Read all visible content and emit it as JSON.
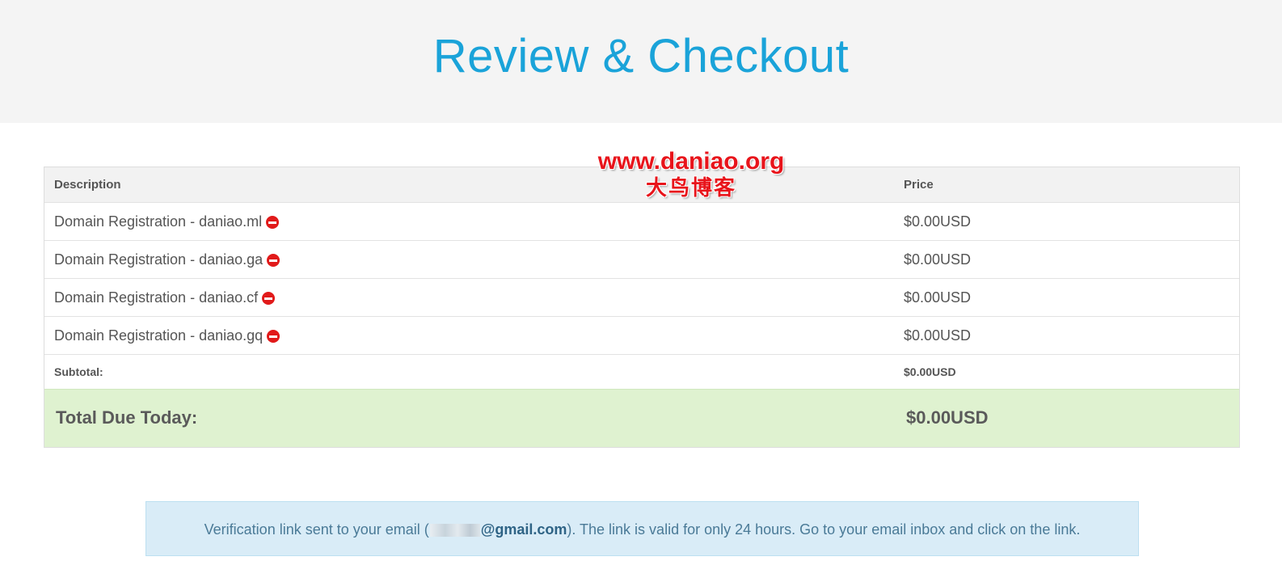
{
  "header": {
    "title": "Review & Checkout"
  },
  "watermark": {
    "url": "www.daniao.org",
    "cn": "大鸟博客"
  },
  "cart": {
    "columns": {
      "description": "Description",
      "price": "Price"
    },
    "items": [
      {
        "description": "Domain Registration - daniao.ml",
        "price": "$0.00USD"
      },
      {
        "description": "Domain Registration - daniao.ga",
        "price": "$0.00USD"
      },
      {
        "description": "Domain Registration - daniao.cf",
        "price": "$0.00USD"
      },
      {
        "description": "Domain Registration - daniao.gq",
        "price": "$0.00USD"
      }
    ],
    "subtotal": {
      "label": "Subtotal:",
      "value": "$0.00USD"
    },
    "total": {
      "label": "Total Due Today:",
      "value": "$0.00USD"
    }
  },
  "alert": {
    "prefix": "Verification link sent to your email (",
    "email_domain": "@gmail.com",
    "suffix": "). The link is valid for only 24 hours. Go to your email inbox and click on the link."
  },
  "icons": {
    "remove": "remove-circle-icon"
  },
  "colors": {
    "title": "#1aa3d9",
    "total_bg": "#dff2d0",
    "alert_bg": "#d9ecf7",
    "remove": "#e11a1a",
    "watermark": "#e8141b"
  }
}
